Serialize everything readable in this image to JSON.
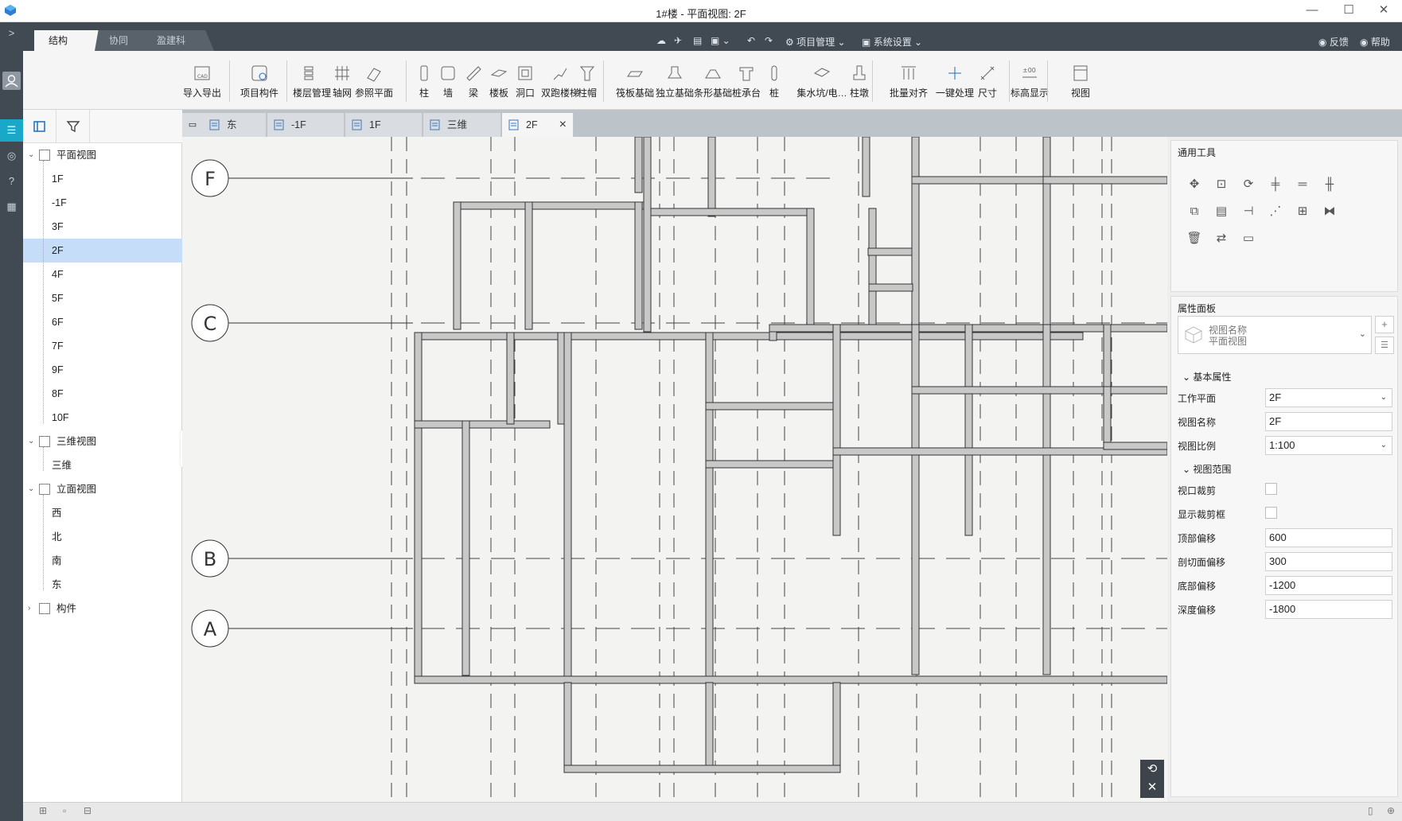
{
  "window": {
    "title": "1#楼 - 平面视图: 2F"
  },
  "ribbon_tabs": [
    {
      "label": "结构"
    },
    {
      "label": "协同"
    },
    {
      "label": "盈建科"
    }
  ],
  "quick_access": {
    "project_mgmt": "项目管理",
    "system_settings": "系统设置",
    "feedback": "反馈",
    "help": "帮助"
  },
  "toolbar": [
    {
      "label": "导入导出",
      "icon": "cad-icon"
    },
    {
      "label": "项目构件",
      "icon": "component-icon"
    },
    {
      "label": "楼层管理",
      "icon": "floor-icon"
    },
    {
      "label": "轴网",
      "icon": "grid-icon"
    },
    {
      "label": "参照平面",
      "icon": "plane-icon"
    },
    {
      "label": "柱",
      "icon": "column-icon"
    },
    {
      "label": "墙",
      "icon": "wall-icon"
    },
    {
      "label": "梁",
      "icon": "beam-icon"
    },
    {
      "label": "楼板",
      "icon": "slab-icon"
    },
    {
      "label": "洞口",
      "icon": "opening-icon"
    },
    {
      "label": "双跑楼梯",
      "icon": "stair-icon"
    },
    {
      "label": "柱帽",
      "icon": "column-cap-icon"
    },
    {
      "label": "筏板基础",
      "icon": "raft-icon"
    },
    {
      "label": "独立基础",
      "icon": "isolated-footing-icon"
    },
    {
      "label": "条形基础",
      "icon": "strip-footing-icon"
    },
    {
      "label": "桩承台",
      "icon": "pile-cap-icon"
    },
    {
      "label": "桩",
      "icon": "pile-icon"
    },
    {
      "label": "集水坑/电…",
      "icon": "sump-icon"
    },
    {
      "label": "柱墩",
      "icon": "pier-icon"
    },
    {
      "label": "批量对齐",
      "icon": "align-icon"
    },
    {
      "label": "一键处理",
      "icon": "process-icon"
    },
    {
      "label": "尺寸",
      "icon": "dimension-icon"
    },
    {
      "label": "标高显示",
      "icon": "elevation-icon"
    },
    {
      "label": "视图",
      "icon": "view-icon"
    }
  ],
  "tree": {
    "plan": {
      "label": "平面视图",
      "items": [
        "1F",
        "-1F",
        "3F",
        "2F",
        "4F",
        "5F",
        "6F",
        "7F",
        "9F",
        "8F",
        "10F"
      ],
      "selected": "2F"
    },
    "threed": {
      "label": "三维视图",
      "items": [
        "三维"
      ]
    },
    "elevation": {
      "label": "立面视图",
      "items": [
        "西",
        "北",
        "南",
        "东"
      ]
    },
    "components": {
      "label": "构件"
    }
  },
  "doc_tabs": [
    {
      "label": "东"
    },
    {
      "label": "-1F"
    },
    {
      "label": "1F"
    },
    {
      "label": "三维"
    },
    {
      "label": "2F"
    }
  ],
  "grid_axes": [
    "F",
    "C",
    "B",
    "A"
  ],
  "tools_panel": {
    "title": "通用工具"
  },
  "props": {
    "title": "属性面板",
    "selector_name": "视图名称",
    "selector_type": "平面视图",
    "section_basic": "基本属性",
    "work_plane": {
      "label": "工作平面",
      "value": "2F"
    },
    "view_name": {
      "label": "视图名称",
      "value": "2F"
    },
    "view_scale": {
      "label": "视图比例",
      "value": "1:100"
    },
    "section_range": "视图范围",
    "crop": {
      "label": "视口裁剪"
    },
    "show_crop": {
      "label": "显示裁剪框"
    },
    "top_offset": {
      "label": "顶部偏移",
      "value": "600"
    },
    "cut_offset": {
      "label": "剖切面偏移",
      "value": "300"
    },
    "bottom_offset": {
      "label": "底部偏移",
      "value": "-1200"
    },
    "depth_offset": {
      "label": "深度偏移",
      "value": "-1800"
    }
  }
}
